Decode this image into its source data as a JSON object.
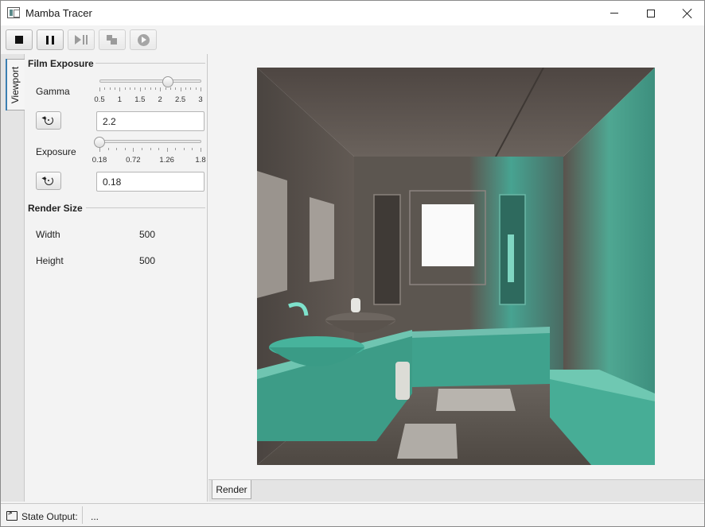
{
  "window": {
    "title": "Mamba Tracer",
    "controls": [
      "minimize",
      "maximize",
      "close"
    ]
  },
  "toolbar": {
    "buttons": [
      {
        "icon": "stop-icon",
        "enabled": true
      },
      {
        "icon": "pause-icon",
        "enabled": true
      },
      {
        "icon": "step-play-icon",
        "enabled": false
      },
      {
        "icon": "render-region-icon",
        "enabled": false
      },
      {
        "icon": "play-circle-icon",
        "enabled": false
      }
    ]
  },
  "side_tabs": [
    {
      "label": "Viewport",
      "active": true
    }
  ],
  "film_exposure": {
    "title": "Film Exposure",
    "gamma": {
      "label": "Gamma",
      "min": 0.5,
      "max": 3,
      "value": 2.2,
      "ticks": [
        "0.5",
        "1",
        "1.5",
        "2",
        "2.5",
        "3"
      ],
      "field_value": "2.2"
    },
    "exposure": {
      "label": "Exposure",
      "min": 0.18,
      "max": 1.8,
      "value": 0.18,
      "ticks": [
        "0.18",
        "0.72",
        "1.26",
        "1.8"
      ],
      "field_value": "0.18"
    }
  },
  "render_size": {
    "title": "Render Size",
    "width_label": "Width",
    "width_value": "500",
    "height_label": "Height",
    "height_value": "500"
  },
  "bottom_tabs": [
    {
      "label": "Render",
      "active": true
    }
  ],
  "status": {
    "label": "State Output:",
    "text": "..."
  },
  "colors": {
    "accent": "#3c7fb1",
    "render_teal": "#4fd1b5",
    "render_wall": "#5e5650"
  }
}
